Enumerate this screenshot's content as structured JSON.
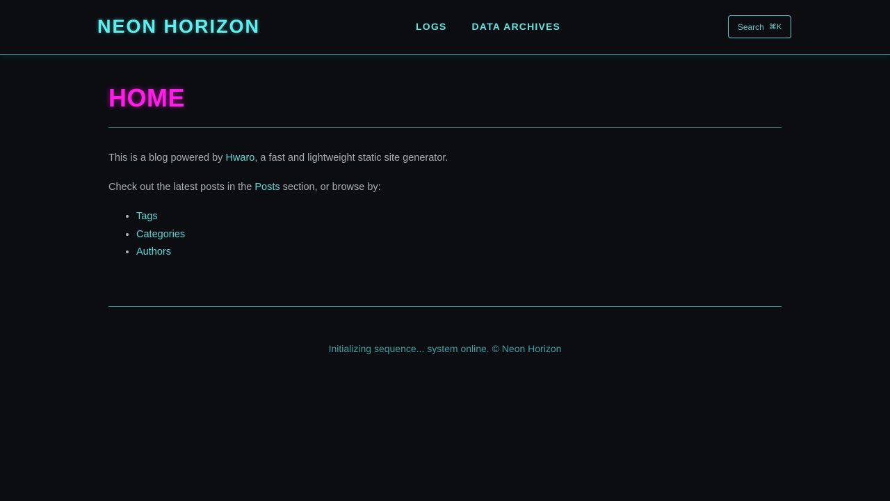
{
  "header": {
    "logo": "NEON HORIZON",
    "nav": [
      {
        "label": "LOGS"
      },
      {
        "label": "DATA ARCHIVES"
      }
    ],
    "search": {
      "label": "Search",
      "shortcut": "⌘K"
    }
  },
  "main": {
    "title": "HOME",
    "intro": {
      "before": "This is a blog powered by ",
      "link": "Hwaro",
      "after": ", a fast and lightweight static site generator."
    },
    "browse": {
      "before": "Check out the latest posts in the ",
      "link": "Posts",
      "after": " section, or browse by:"
    },
    "list": [
      {
        "label": "Tags"
      },
      {
        "label": "Categories"
      },
      {
        "label": "Authors"
      }
    ]
  },
  "footer": {
    "text": "Initializing sequence... system online. © Neon Horizon"
  },
  "colors": {
    "background": "#0b0d11",
    "accent_cyan": "#5fefef",
    "title_magenta": "#ff1ee8",
    "body_text": "#a6adb2",
    "rule": "#3a8c91"
  }
}
